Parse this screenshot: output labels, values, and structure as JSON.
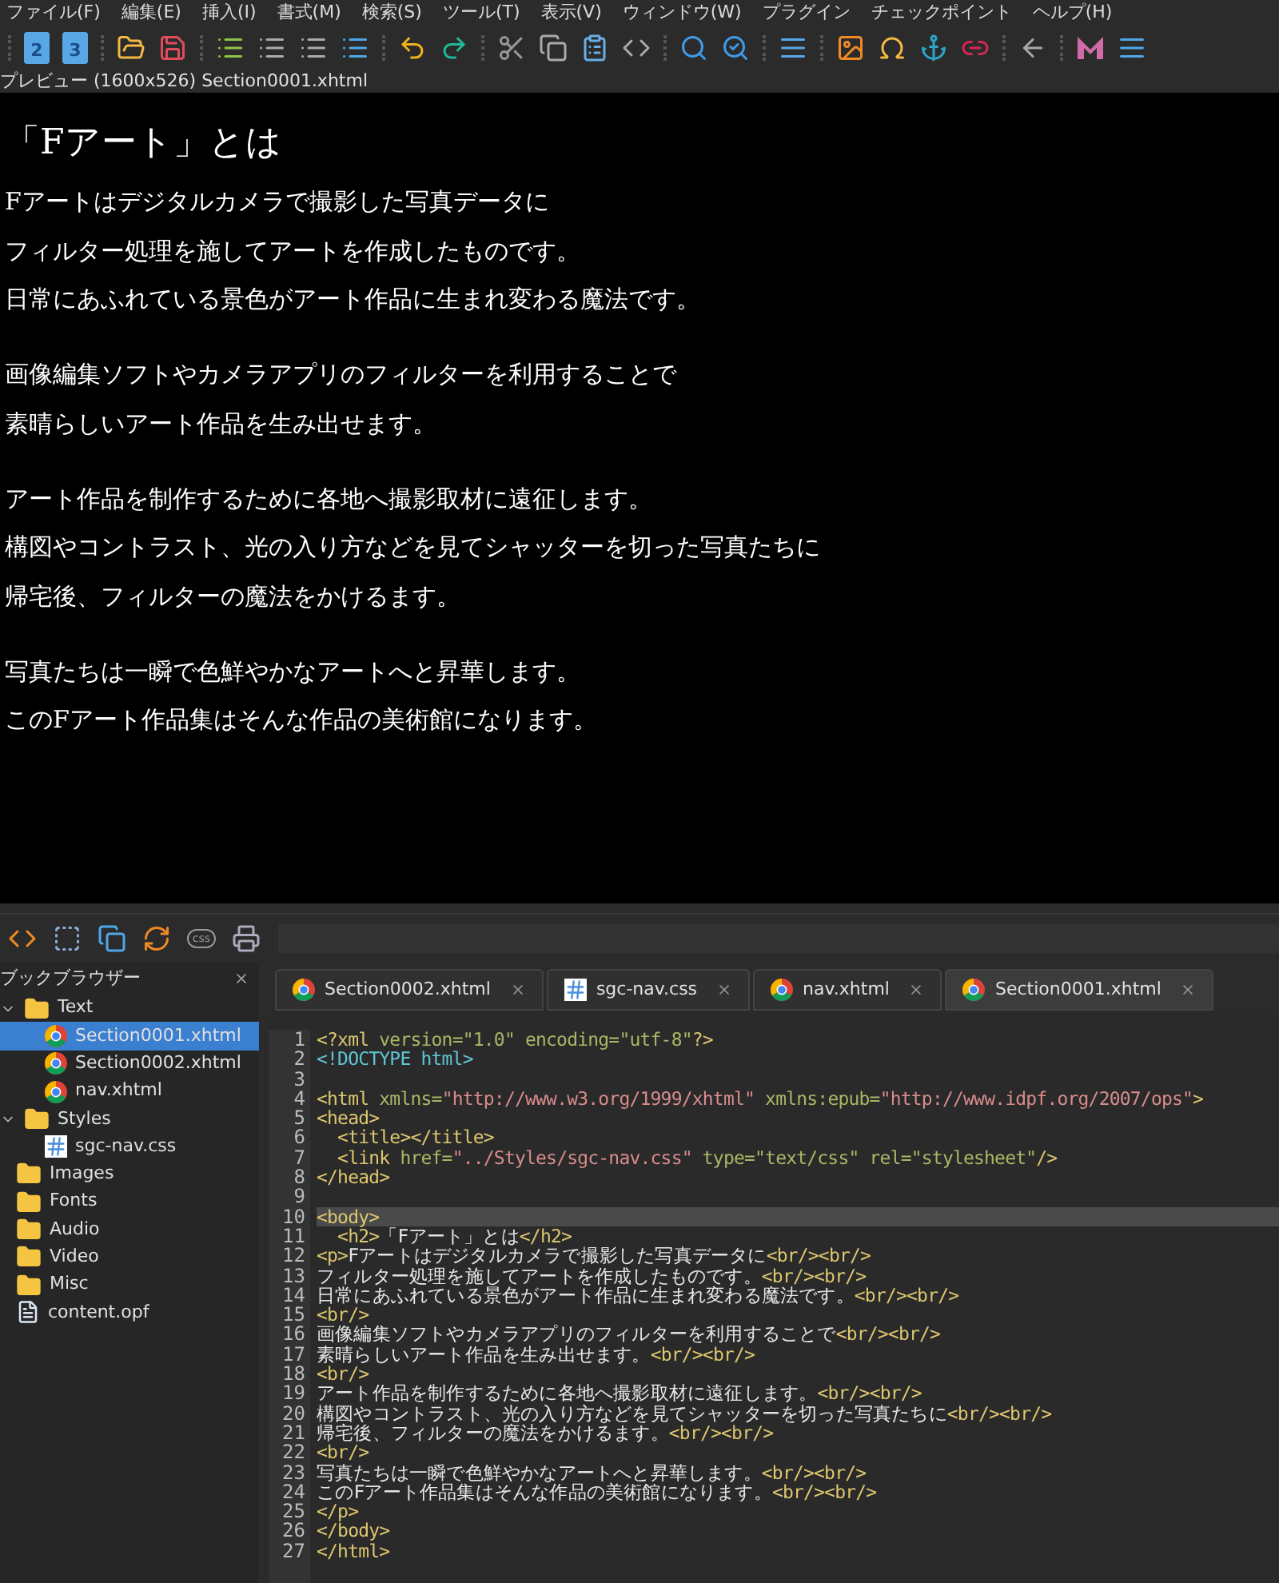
{
  "menu": [
    "ファイル(F)",
    "編集(E)",
    "挿入(I)",
    "書式(M)",
    "検索(S)",
    "ツール(T)",
    "表示(V)",
    "ウィンドウ(W)",
    "プラグイン",
    "チェックポイント",
    "ヘルプ(H)"
  ],
  "toolbar": {
    "badges": [
      "2",
      "3"
    ]
  },
  "preview": {
    "label": "プレビュー (1600x526) Section0001.xhtml",
    "heading": "「Fアート」とは",
    "paragraphs": [
      [
        "Fアートはデジタルカメラで撮影した写真データに",
        "フィルター処理を施してアートを作成したものです。",
        "日常にあふれている景色がアート作品に生まれ変わる魔法です。"
      ],
      [
        "画像編集ソフトやカメラアプリのフィルターを利用することで",
        "素晴らしいアート作品を生み出せます。"
      ],
      [
        "アート作品を制作するために各地へ撮影取材に遠征します。",
        "構図やコントラスト、光の入り方などを見てシャッターを切った写真たちに",
        "帰宅後、フィルターの魔法をかけるます。"
      ],
      [
        "写真たちは一瞬で色鮮やかなアートへと昇華します。",
        "このFアート作品集はそんな作品の美術館になります。"
      ]
    ]
  },
  "book_browser": {
    "title": "ブックブラウザー",
    "items": [
      {
        "label": "Text",
        "kind": "folder",
        "expanded": true,
        "selected": false,
        "children": [
          {
            "label": "Section0001.xhtml",
            "kind": "html",
            "selected": true
          },
          {
            "label": "Section0002.xhtml",
            "kind": "html",
            "selected": false
          },
          {
            "label": "nav.xhtml",
            "kind": "html",
            "selected": false
          }
        ]
      },
      {
        "label": "Styles",
        "kind": "folder",
        "expanded": true,
        "selected": false,
        "children": [
          {
            "label": "sgc-nav.css",
            "kind": "css",
            "selected": false
          }
        ]
      },
      {
        "label": "Images",
        "kind": "folder",
        "selected": false
      },
      {
        "label": "Fonts",
        "kind": "folder",
        "selected": false
      },
      {
        "label": "Audio",
        "kind": "folder",
        "selected": false
      },
      {
        "label": "Video",
        "kind": "folder",
        "selected": false
      },
      {
        "label": "Misc",
        "kind": "folder",
        "selected": false
      },
      {
        "label": "content.opf",
        "kind": "opf",
        "selected": false
      }
    ]
  },
  "tabs": [
    {
      "label": "Section0002.xhtml",
      "kind": "html",
      "selected": false
    },
    {
      "label": "sgc-nav.css",
      "kind": "css",
      "selected": false
    },
    {
      "label": "nav.xhtml",
      "kind": "html",
      "selected": false
    },
    {
      "label": "Section0001.xhtml",
      "kind": "html",
      "selected": true
    }
  ],
  "code": [
    {
      "number": "1",
      "current": false,
      "segments": [
        {
          "kind": "tag",
          "text": "<?xml "
        },
        {
          "kind": "attr",
          "text": "version=\"1.0\" encoding=\"utf-8\""
        },
        {
          "kind": "tag",
          "text": "?>"
        }
      ]
    },
    {
      "number": "2",
      "current": false,
      "segments": [
        {
          "kind": "doctype",
          "text": "<!DOCTYPE html>"
        }
      ]
    },
    {
      "number": "3",
      "current": false
    },
    {
      "number": "4",
      "current": false,
      "segments": [
        {
          "kind": "tag",
          "text": "<html "
        },
        {
          "kind": "attr",
          "text": "xmlns="
        },
        {
          "kind": "string",
          "text": "\"http://www.w3.org/1999/xhtml\""
        },
        {
          "kind": "attr",
          "text": " xmlns:epub="
        },
        {
          "kind": "string",
          "text": "\"http://www.idpf.org/2007/ops\""
        },
        {
          "kind": "tag",
          "text": ">"
        }
      ]
    },
    {
      "number": "5",
      "current": false,
      "segments": [
        {
          "kind": "tag",
          "text": "<head>"
        }
      ]
    },
    {
      "number": "6",
      "current": false,
      "segments": [
        {
          "kind": "tag",
          "text": "  <title></title>"
        }
      ]
    },
    {
      "number": "7",
      "current": false,
      "segments": [
        {
          "kind": "tag",
          "text": "  <link "
        },
        {
          "kind": "attr",
          "text": "href="
        },
        {
          "kind": "string",
          "text": "\"../Styles/sgc-nav.css\""
        },
        {
          "kind": "attr",
          "text": " type=\"text/css\" rel=\"stylesheet\""
        },
        {
          "kind": "tag",
          "text": "/>"
        }
      ]
    },
    {
      "number": "8",
      "current": false,
      "segments": [
        {
          "kind": "tag",
          "text": "</head>"
        }
      ]
    },
    {
      "number": "9",
      "current": false
    },
    {
      "number": "10",
      "current": true,
      "segments": [
        {
          "kind": "tag",
          "text": "<body>"
        }
      ]
    },
    {
      "number": "11",
      "current": false,
      "segments": [
        {
          "kind": "tag",
          "text": "  <h2>"
        },
        {
          "kind": "text",
          "text": "「Fアート」とは"
        },
        {
          "kind": "tag",
          "text": "</h2>"
        }
      ]
    },
    {
      "number": "12",
      "current": false,
      "segments": [
        {
          "kind": "tag",
          "text": "<p>"
        },
        {
          "kind": "text",
          "text": "Fアートはデジタルカメラで撮影した写真データに"
        },
        {
          "kind": "tag",
          "text": "<br/><br/>"
        }
      ]
    },
    {
      "number": "13",
      "current": false,
      "segments": [
        {
          "kind": "text",
          "text": "フィルター処理を施してアートを作成したものです。"
        },
        {
          "kind": "tag",
          "text": "<br/><br/>"
        }
      ]
    },
    {
      "number": "14",
      "current": false,
      "segments": [
        {
          "kind": "text",
          "text": "日常にあふれている景色がアート作品に生まれ変わる魔法です。"
        },
        {
          "kind": "tag",
          "text": "<br/><br/>"
        }
      ]
    },
    {
      "number": "15",
      "current": false,
      "segments": [
        {
          "kind": "tag",
          "text": "<br/>"
        }
      ]
    },
    {
      "number": "16",
      "current": false,
      "segments": [
        {
          "kind": "text",
          "text": "画像編集ソフトやカメラアプリのフィルターを利用することで"
        },
        {
          "kind": "tag",
          "text": "<br/><br/>"
        }
      ]
    },
    {
      "number": "17",
      "current": false,
      "segments": [
        {
          "kind": "text",
          "text": "素晴らしいアート作品を生み出せます。"
        },
        {
          "kind": "tag",
          "text": "<br/><br/>"
        }
      ]
    },
    {
      "number": "18",
      "current": false,
      "segments": [
        {
          "kind": "tag",
          "text": "<br/>"
        }
      ]
    },
    {
      "number": "19",
      "current": false,
      "segments": [
        {
          "kind": "text",
          "text": "アート作品を制作するために各地へ撮影取材に遠征します。"
        },
        {
          "kind": "tag",
          "text": "<br/><br/>"
        }
      ]
    },
    {
      "number": "20",
      "current": false,
      "segments": [
        {
          "kind": "text",
          "text": "構図やコントラスト、光の入り方などを見てシャッターを切った写真たちに"
        },
        {
          "kind": "tag",
          "text": "<br/><br/>"
        }
      ]
    },
    {
      "number": "21",
      "current": false,
      "segments": [
        {
          "kind": "text",
          "text": "帰宅後、フィルターの魔法をかけるます。"
        },
        {
          "kind": "tag",
          "text": "<br/><br/>"
        }
      ]
    },
    {
      "number": "22",
      "current": false,
      "segments": [
        {
          "kind": "tag",
          "text": "<br/>"
        }
      ]
    },
    {
      "number": "23",
      "current": false,
      "segments": [
        {
          "kind": "text",
          "text": "写真たちは一瞬で色鮮やかなアートへと昇華します。"
        },
        {
          "kind": "tag",
          "text": "<br/><br/>"
        }
      ]
    },
    {
      "number": "24",
      "current": false,
      "segments": [
        {
          "kind": "text",
          "text": "このFアート作品集はそんな作品の美術館になります。"
        },
        {
          "kind": "tag",
          "text": "<br/><br/>"
        }
      ]
    },
    {
      "number": "25",
      "current": false,
      "segments": [
        {
          "kind": "tag",
          "text": "</p>"
        }
      ]
    },
    {
      "number": "26",
      "current": false,
      "segments": [
        {
          "kind": "tag",
          "text": "</body>"
        }
      ]
    },
    {
      "number": "27",
      "current": false,
      "segments": [
        {
          "kind": "tag",
          "text": "</html>"
        }
      ]
    }
  ]
}
